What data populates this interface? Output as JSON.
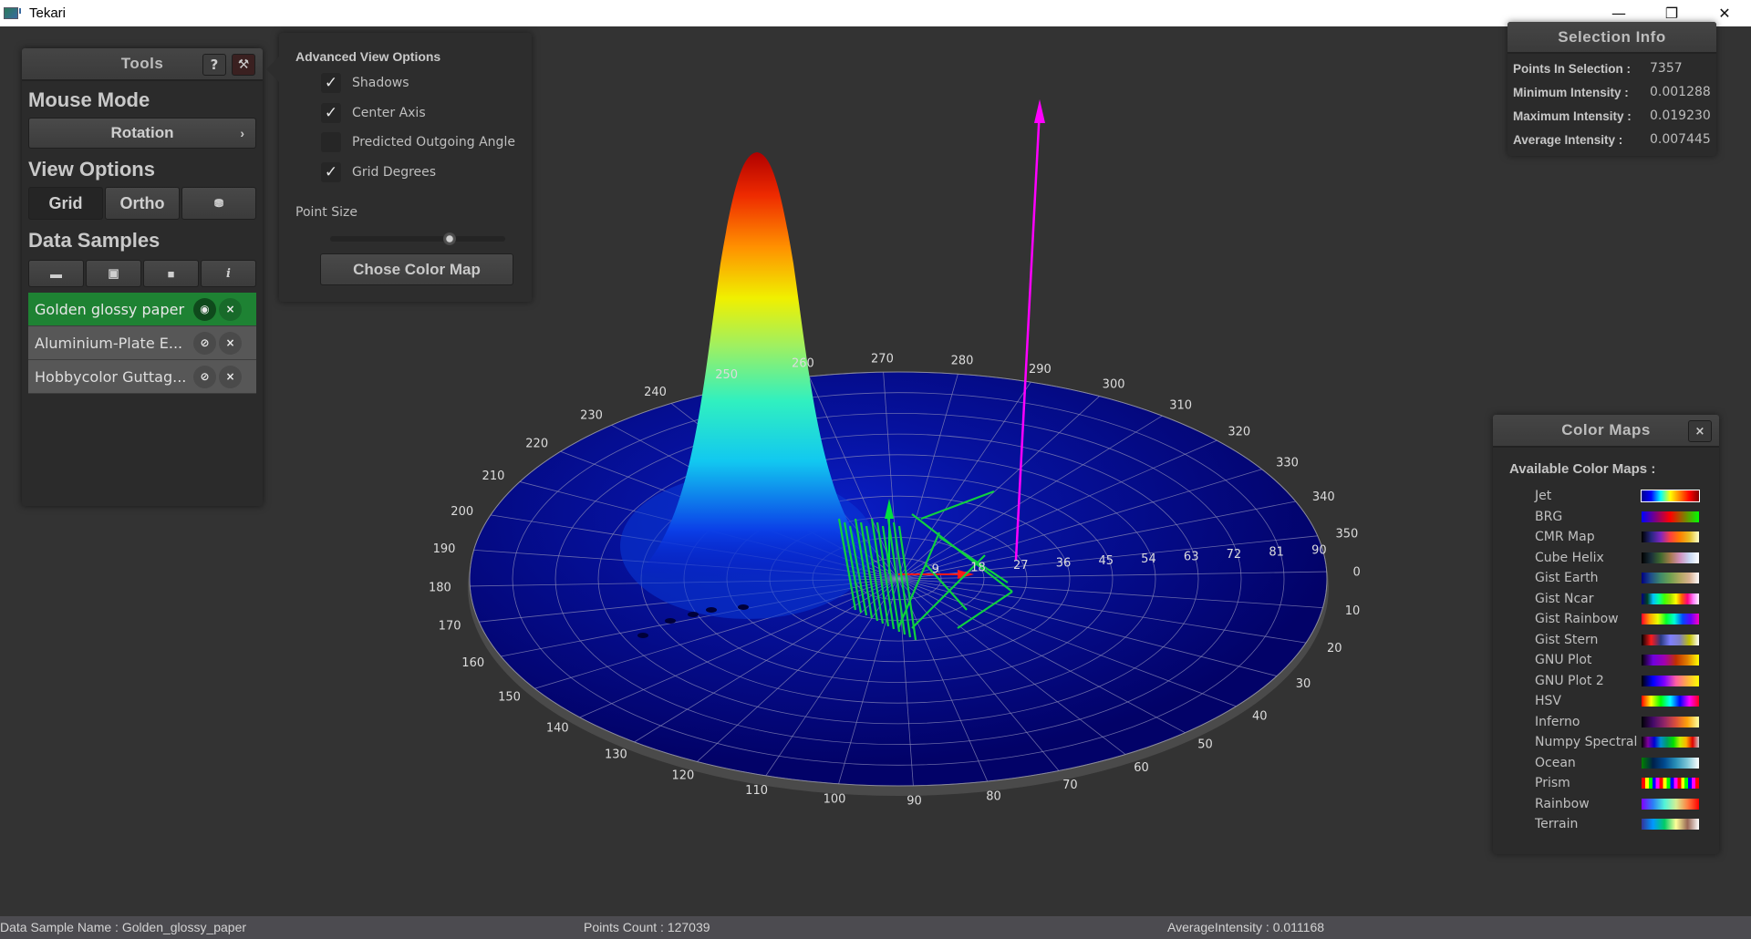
{
  "window": {
    "title": "Tekari",
    "controls": {
      "minimize": "—",
      "maximize": "❐",
      "close": "✕"
    }
  },
  "tools_panel": {
    "title": "Tools",
    "help_label": "?",
    "tools_icon": "⚒",
    "mouse_mode": {
      "title": "Mouse Mode",
      "value": "Rotation",
      "chevron": "›"
    },
    "view_options": {
      "title": "View Options",
      "buttons": [
        {
          "label": "Grid",
          "active": true
        },
        {
          "label": "Ortho",
          "active": false
        },
        {
          "label": "⛃",
          "icon": "camera-reset-icon",
          "active": false
        }
      ]
    },
    "data_samples": {
      "title": "Data Samples",
      "actions": [
        {
          "icon": "folder-open-icon",
          "glyph": "▬"
        },
        {
          "icon": "image-icon",
          "glyph": "▣"
        },
        {
          "icon": "save-icon",
          "glyph": "■"
        },
        {
          "icon": "info-icon",
          "glyph": "i"
        }
      ],
      "items": [
        {
          "name": "Golden glossy paper",
          "visible": true,
          "selected": true,
          "eye_glyph": "◉",
          "remove_glyph": "×"
        },
        {
          "name": "Aluminium-Plate E...",
          "visible": false,
          "selected": false,
          "eye_glyph": "⊘",
          "remove_glyph": "×"
        },
        {
          "name": "Hobbycolor Guttag...",
          "visible": false,
          "selected": false,
          "eye_glyph": "⊘",
          "remove_glyph": "×"
        }
      ]
    }
  },
  "advanced_view_options": {
    "title": "Advanced View Options",
    "checkboxes": [
      {
        "label": "Shadows",
        "checked": true
      },
      {
        "label": "Center Axis",
        "checked": true
      },
      {
        "label": "Predicted Outgoing Angle",
        "checked": false
      },
      {
        "label": "Grid Degrees",
        "checked": true
      }
    ],
    "check_glyph": "✓",
    "point_size": {
      "label": "Point Size",
      "value_fraction": 0.68
    },
    "color_map_button": "Chose Color Map"
  },
  "selection_info": {
    "title": "Selection Info",
    "rows": [
      {
        "key": "Points In Selection :",
        "value": "7357"
      },
      {
        "key": "Minimum Intensity :",
        "value": "0.001288"
      },
      {
        "key": "Maximum Intensity :",
        "value": "0.019230"
      },
      {
        "key": "Average Intensity :",
        "value": "0.007445"
      }
    ]
  },
  "color_maps": {
    "title": "Color Maps",
    "close_label": "×",
    "heading": "Available Color Maps :",
    "items": [
      {
        "name": "Jet",
        "selected": true,
        "stops": [
          "#00008f",
          "#0000ff",
          "#00ffff",
          "#ffff00",
          "#ff7f00",
          "#ff0000",
          "#800000"
        ]
      },
      {
        "name": "BRG",
        "selected": false,
        "stops": [
          "#0000ff",
          "#7f007f",
          "#ff0000",
          "#7f7f00",
          "#00ff00"
        ]
      },
      {
        "name": "CMR Map",
        "selected": false,
        "stops": [
          "#000000",
          "#26267f",
          "#7f26bf",
          "#ff3f3f",
          "#ff7f00",
          "#e5bf26",
          "#ffffcc"
        ]
      },
      {
        "name": "Cube Helix",
        "selected": false,
        "stops": [
          "#000000",
          "#1a2f3a",
          "#3f6b2e",
          "#a67a4c",
          "#d08fbc",
          "#c6d6f2",
          "#ffffff"
        ]
      },
      {
        "name": "Gist Earth",
        "selected": false,
        "stops": [
          "#000080",
          "#1f4f8a",
          "#3f8a6a",
          "#70a050",
          "#b0a860",
          "#d8b090",
          "#fdfbfb"
        ]
      },
      {
        "name": "Gist Ncar",
        "selected": false,
        "stops": [
          "#000080",
          "#004020",
          "#00c0ff",
          "#00ffa0",
          "#40ff00",
          "#a0e000",
          "#ffff00",
          "#ff6000",
          "#ff0080",
          "#ff80ff",
          "#fef8fe"
        ]
      },
      {
        "name": "Gist Rainbow",
        "selected": false,
        "stops": [
          "#ff0029",
          "#ffa100",
          "#e6ff00",
          "#00ff2a",
          "#00ffd6",
          "#0049ff",
          "#6600ff",
          "#ff00bf"
        ]
      },
      {
        "name": "Gist Stern",
        "selected": false,
        "stops": [
          "#000000",
          "#ff1a1a",
          "#2a3a80",
          "#7f7fff",
          "#8080c0",
          "#c0c000",
          "#ffffff"
        ]
      },
      {
        "name": "GNU Plot",
        "selected": false,
        "stops": [
          "#000000",
          "#7000e0",
          "#a000b0",
          "#c03000",
          "#e08000",
          "#ffff00"
        ]
      },
      {
        "name": "GNU Plot 2",
        "selected": false,
        "stops": [
          "#000000",
          "#0000ff",
          "#8000ff",
          "#ff60a0",
          "#ffb040",
          "#ffff00"
        ]
      },
      {
        "name": "HSV",
        "selected": false,
        "stops": [
          "#ff0000",
          "#ffff00",
          "#00ff00",
          "#00ffff",
          "#0000ff",
          "#ff00ff",
          "#ff0018"
        ]
      },
      {
        "name": "Inferno",
        "selected": false,
        "stops": [
          "#000004",
          "#420a68",
          "#932667",
          "#dd513a",
          "#fca50a",
          "#fcffa4"
        ]
      },
      {
        "name": "Numpy Spectral",
        "selected": false,
        "stops": [
          "#000000",
          "#8000a0",
          "#0000d0",
          "#0090d0",
          "#00a060",
          "#00e000",
          "#c0f000",
          "#ffb000",
          "#e00000",
          "#cccccc"
        ]
      },
      {
        "name": "Ocean",
        "selected": false,
        "stops": [
          "#008000",
          "#00204a",
          "#004a90",
          "#2a90b8",
          "#80c8d8",
          "#ffffff"
        ]
      },
      {
        "name": "Prism",
        "selected": false,
        "stops": [
          "#ff0000",
          "#ffff00",
          "#00ff00",
          "#0000ff",
          "#ff00ff",
          "#ff0000",
          "#ffff00",
          "#00ff00",
          "#0000ff",
          "#ff00ff",
          "#ff0000",
          "#ffff00",
          "#00ff00",
          "#0000ff",
          "#ff00ff",
          "#ff0000"
        ]
      },
      {
        "name": "Rainbow",
        "selected": false,
        "stops": [
          "#8000ff",
          "#2a7ff6",
          "#50f4d8",
          "#d4f094",
          "#ff7f41",
          "#ff0000"
        ]
      },
      {
        "name": "Terrain",
        "selected": false,
        "stops": [
          "#333399",
          "#0099ff",
          "#00cc66",
          "#ffff99",
          "#996655",
          "#ffffff"
        ]
      }
    ]
  },
  "plot": {
    "azimuth_labels": [
      "0",
      "10",
      "20",
      "30",
      "40",
      "50",
      "60",
      "70",
      "80",
      "90",
      "100",
      "110",
      "120",
      "130",
      "140",
      "150",
      "160",
      "170",
      "180",
      "190",
      "200",
      "210",
      "220",
      "230",
      "240",
      "250",
      "260",
      "270",
      "280",
      "290",
      "300",
      "310",
      "320",
      "330",
      "340",
      "350"
    ],
    "elevation_labels": [
      "9",
      "18",
      "27",
      "36",
      "45",
      "54",
      "63",
      "72",
      "81",
      "90"
    ],
    "colormap_in_use": "Jet",
    "disk_color": "#00005a",
    "grid_color": "#8a8ab8",
    "outgoing_axis_color": "#ff00ff",
    "center_axis_colors": {
      "x": "#ff1a1a",
      "y": "#00e040"
    }
  },
  "status_bar": {
    "sample_name": "Data Sample Name : Golden_glossy_paper",
    "points_count": "Points Count : 127039",
    "average_intensity": "AverageIntensity : 0.011168"
  }
}
